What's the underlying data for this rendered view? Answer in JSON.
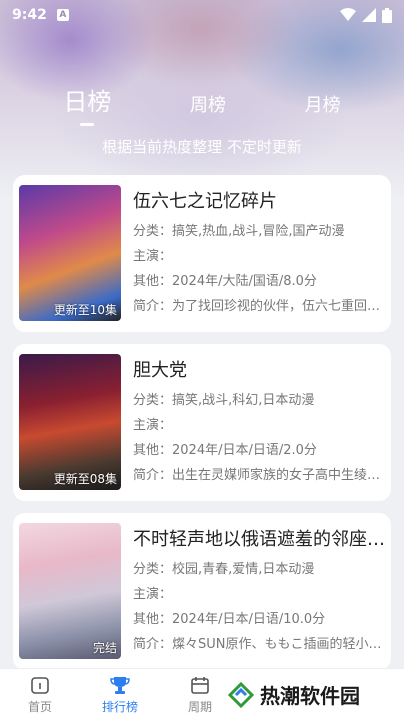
{
  "status_bar": {
    "time": "9:42",
    "notification_letter": "A"
  },
  "tabs": [
    {
      "label": "日榜",
      "active": true
    },
    {
      "label": "周榜",
      "active": false
    },
    {
      "label": "月榜",
      "active": false
    }
  ],
  "subtitle": "根据当前热度整理 不定时更新",
  "items": [
    {
      "title": "伍六七之记忆碎片",
      "badge": "更新至10集",
      "genre_label": "分类：",
      "genre": "搞笑,热血,战斗,冒险,国产动漫",
      "cast_label": "主演：",
      "cast": "",
      "other_label": "其他：",
      "other": "2024年/大陆/国语/8.0分",
      "intro_label": "简介：",
      "intro": "为了找回珍视的伙伴，伍六七重回…"
    },
    {
      "title": "胆大党",
      "badge": "更新至08集",
      "genre_label": "分类：",
      "genre": "搞笑,战斗,科幻,日本动漫",
      "cast_label": "主演：",
      "cast": "",
      "other_label": "其他：",
      "other": "2024年/日本/日语/2.0分",
      "intro_label": "简介：",
      "intro": "出生在灵媒师家族的女子高中生绫…"
    },
    {
      "title": "不时轻声地以俄语遮羞的邻座…",
      "badge": "完结",
      "genre_label": "分类：",
      "genre": "校园,青春,爱情,日本动漫",
      "cast_label": "主演：",
      "cast": "",
      "other_label": "其他：",
      "other": "2024年/日本/日语/10.0分",
      "intro_label": "简介：",
      "intro": "燦々SUN原作、ももこ插画的轻小…"
    }
  ],
  "bottom_nav": [
    {
      "label": "首页",
      "icon": "home-icon",
      "active": false
    },
    {
      "label": "排行榜",
      "icon": "trophy-icon",
      "active": true
    },
    {
      "label": "周期",
      "icon": "calendar-icon",
      "active": false
    }
  ],
  "watermark": "热潮软件园",
  "colors": {
    "accent": "#2d7ff0",
    "card_bg": "#ffffff",
    "page_bg": "#eef0f4"
  }
}
